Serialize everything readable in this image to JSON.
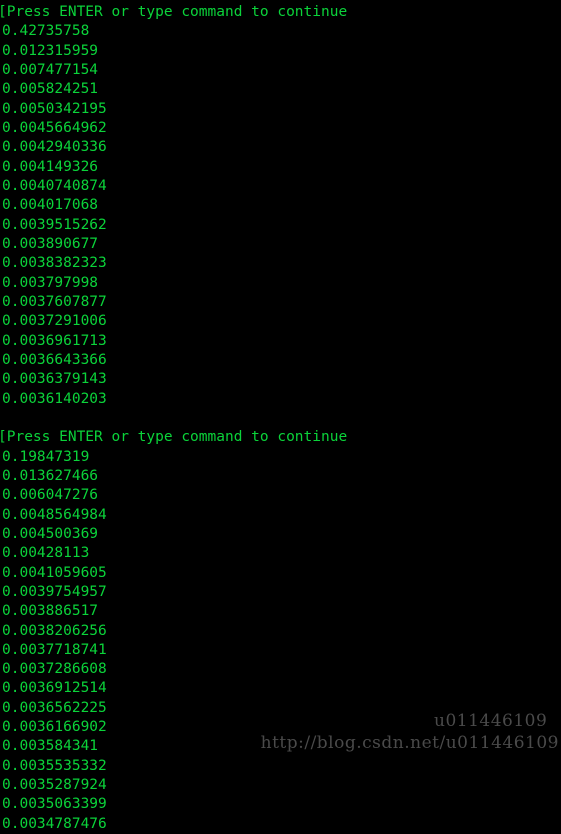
{
  "terminal": {
    "colors": {
      "background": "#000000",
      "foreground": "#0bd33a",
      "watermark": "#4a4a4a"
    },
    "blocks": [
      {
        "prompt": "[Press ENTER or type command to continue",
        "values": [
          "0.42735758",
          "0.012315959",
          "0.007477154",
          "0.005824251",
          "0.0050342195",
          "0.0045664962",
          "0.0042940336",
          "0.004149326",
          "0.0040740874",
          "0.004017068",
          "0.0039515262",
          "0.003890677",
          "0.0038382323",
          "0.003797998",
          "0.0037607877",
          "0.0037291006",
          "0.0036961713",
          "0.0036643366",
          "0.0036379143",
          "0.0036140203"
        ]
      },
      {
        "prompt": "[Press ENTER or type command to continue",
        "values": [
          "0.19847319",
          "0.013627466",
          "0.006047276",
          "0.0048564984",
          "0.004500369",
          "0.00428113",
          "0.0041059605",
          "0.0039754957",
          "0.003886517",
          "0.0038206256",
          "0.0037718741",
          "0.0037286608",
          "0.0036912514",
          "0.0036562225",
          "0.0036166902",
          "0.003584341",
          "0.0035535332",
          "0.0035287924",
          "0.0035063399",
          "0.0034787476"
        ]
      }
    ]
  },
  "watermark": {
    "url": "http://blog.csdn.net/u011446109",
    "overlap": "u011446109"
  }
}
